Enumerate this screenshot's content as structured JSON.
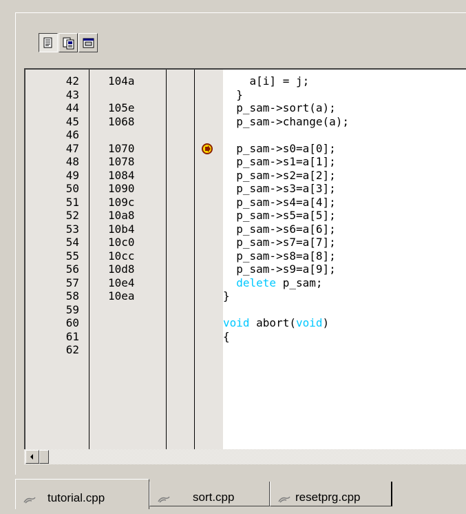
{
  "toolbar": {
    "buttons": [
      {
        "name": "source-mode-icon"
      },
      {
        "name": "mixed-mode-icon"
      },
      {
        "name": "disassembly-mode-icon"
      }
    ]
  },
  "source": {
    "rows": [
      {
        "line": "42",
        "addr": "104a",
        "code": "    a[i] = j;"
      },
      {
        "line": "43",
        "addr": "",
        "code": "  }"
      },
      {
        "line": "44",
        "addr": "105e",
        "code": "  p_sam->sort(a);"
      },
      {
        "line": "45",
        "addr": "1068",
        "code": "  p_sam->change(a);"
      },
      {
        "line": "46",
        "addr": "",
        "code": ""
      },
      {
        "line": "47",
        "addr": "1070",
        "code": "  p_sam->s0=a[0];"
      },
      {
        "line": "48",
        "addr": "1078",
        "code": "  p_sam->s1=a[1];"
      },
      {
        "line": "49",
        "addr": "1084",
        "code": "  p_sam->s2=a[2];"
      },
      {
        "line": "50",
        "addr": "1090",
        "code": "  p_sam->s3=a[3];"
      },
      {
        "line": "51",
        "addr": "109c",
        "code": "  p_sam->s4=a[4];"
      },
      {
        "line": "52",
        "addr": "10a8",
        "code": "  p_sam->s5=a[5];"
      },
      {
        "line": "53",
        "addr": "10b4",
        "code": "  p_sam->s6=a[6];"
      },
      {
        "line": "54",
        "addr": "10c0",
        "code": "  p_sam->s7=a[7];"
      },
      {
        "line": "55",
        "addr": "10cc",
        "code": "  p_sam->s8=a[8];"
      },
      {
        "line": "56",
        "addr": "10d8",
        "code": "  p_sam->s9=a[9];"
      },
      {
        "line": "57",
        "addr": "10e4",
        "code_kw": "delete",
        "code_rest": " p_sam;"
      },
      {
        "line": "58",
        "addr": "10ea",
        "code": "}"
      },
      {
        "line": "59",
        "addr": "",
        "code": ""
      },
      {
        "line": "60",
        "addr": "",
        "code_parts": [
          "void",
          " abort(",
          "void",
          ")"
        ]
      },
      {
        "line": "61",
        "addr": "",
        "code": "{"
      },
      {
        "line": "62",
        "addr": "",
        "code": ""
      }
    ],
    "pc_marker_line": "47",
    "keyword_color": "#00c8ff"
  },
  "tabs": [
    {
      "label": "tutorial.cpp",
      "active": true
    },
    {
      "label": "sort.cpp",
      "active": false
    },
    {
      "label": "resetprg.cpp",
      "active": false
    }
  ]
}
